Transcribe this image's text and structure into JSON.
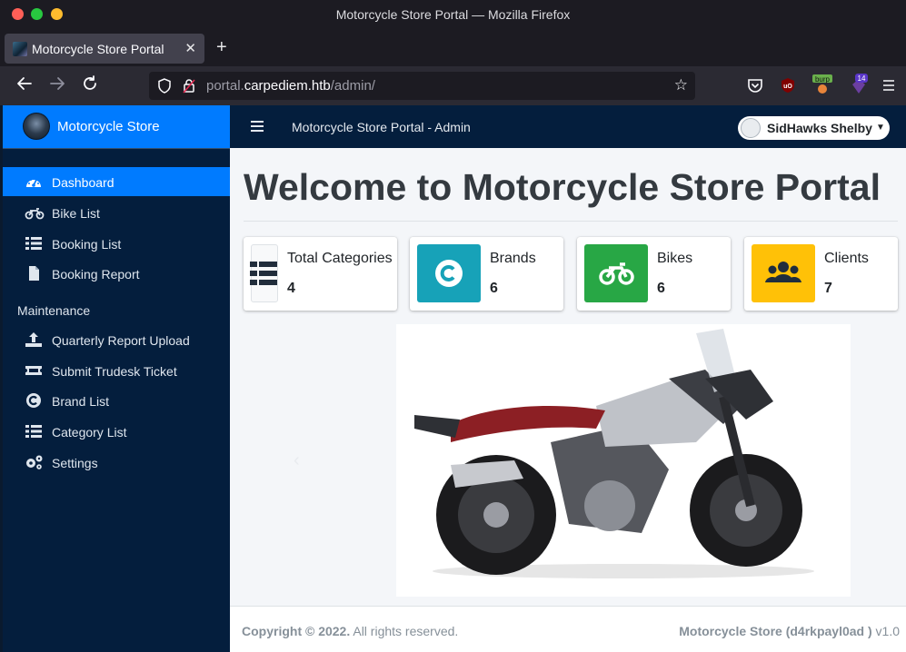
{
  "window": {
    "title": "Motorcycle Store Portal — Mozilla Firefox"
  },
  "browser": {
    "tab_title": "Motorcycle Store Portal",
    "url_prefix": "portal.",
    "url_host": "carpediem.htb",
    "url_path": "/admin/",
    "extensions": [
      "pocket-icon",
      "ublock-icon",
      "burp-icon",
      "privacy-badger-icon"
    ],
    "ext_burp_label": "burp",
    "ext_badge_count": "14"
  },
  "sidebar": {
    "brand": "Motorcycle Store",
    "items": [
      {
        "label": "Dashboard",
        "icon": "dashboard-gauge-icon",
        "active": true
      },
      {
        "label": "Bike List",
        "icon": "motorcycle-icon"
      },
      {
        "label": "Booking List",
        "icon": "th-list-icon"
      },
      {
        "label": "Booking Report",
        "icon": "file-icon"
      }
    ],
    "maintenance_header": "Maintenance",
    "maintenance_items": [
      {
        "label": "Quarterly Report Upload",
        "icon": "upload-icon"
      },
      {
        "label": "Submit Trudesk Ticket",
        "icon": "ticket-icon"
      },
      {
        "label": "Brand List",
        "icon": "copyright-icon"
      },
      {
        "label": "Category List",
        "icon": "th-list-icon"
      },
      {
        "label": "Settings",
        "icon": "cogs-icon"
      }
    ]
  },
  "topnav": {
    "title": "Motorcycle Store Portal - Admin",
    "user_name": "SidHawks Shelby"
  },
  "main": {
    "heading": "Welcome to Motorcycle Store Portal",
    "stats": [
      {
        "label": "Total Categories",
        "value": "4",
        "color": "#e9ecef",
        "icon": "list-icon"
      },
      {
        "label": "Brands",
        "value": "6",
        "color": "#17a2b8",
        "icon": "copyright-icon"
      },
      {
        "label": "Bikes",
        "value": "6",
        "color": "#28a745",
        "icon": "motorcycle-icon"
      },
      {
        "label": "Clients",
        "value": "7",
        "color": "#ffc107",
        "icon": "users-icon"
      }
    ],
    "carousel_image": "adventure-motorcycle-image"
  },
  "footer": {
    "copyright": "Copyright © 2022.",
    "rights": "All rights reserved.",
    "store_name": "Motorcycle Store (d4rkpayl0ad )",
    "version": "v1.0"
  },
  "colors": {
    "primary": "#007bff",
    "sidebar_bg": "#041e3d",
    "content_bg": "#f4f6f9"
  }
}
